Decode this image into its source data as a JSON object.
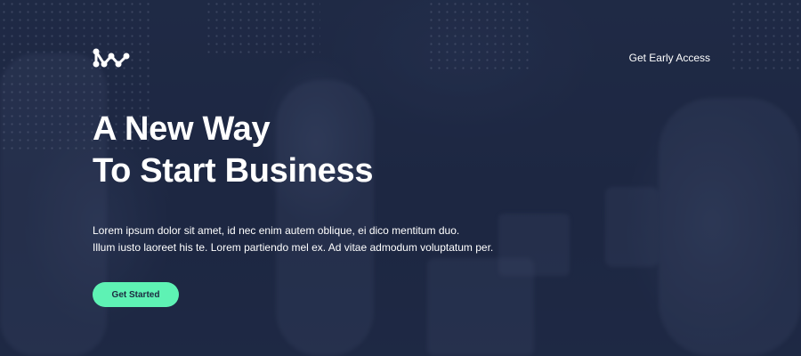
{
  "brand": {
    "logo_icon": "molecule-network-icon",
    "accent_color": "#5ef2b4",
    "background_color": "#1f2b46"
  },
  "nav": {
    "early_access_label": "Get Early Access"
  },
  "hero": {
    "title_line1": "A New Way",
    "title_line2": "To Start Business",
    "description_line1": "Lorem ipsum dolor sit amet, id nec enim autem oblique, ei dico mentitum duo.",
    "description_line2": "Illum iusto laoreet his te. Lorem partiendo mel ex. Ad vitae admodum voluptatum per.",
    "cta_label": "Get Started"
  }
}
